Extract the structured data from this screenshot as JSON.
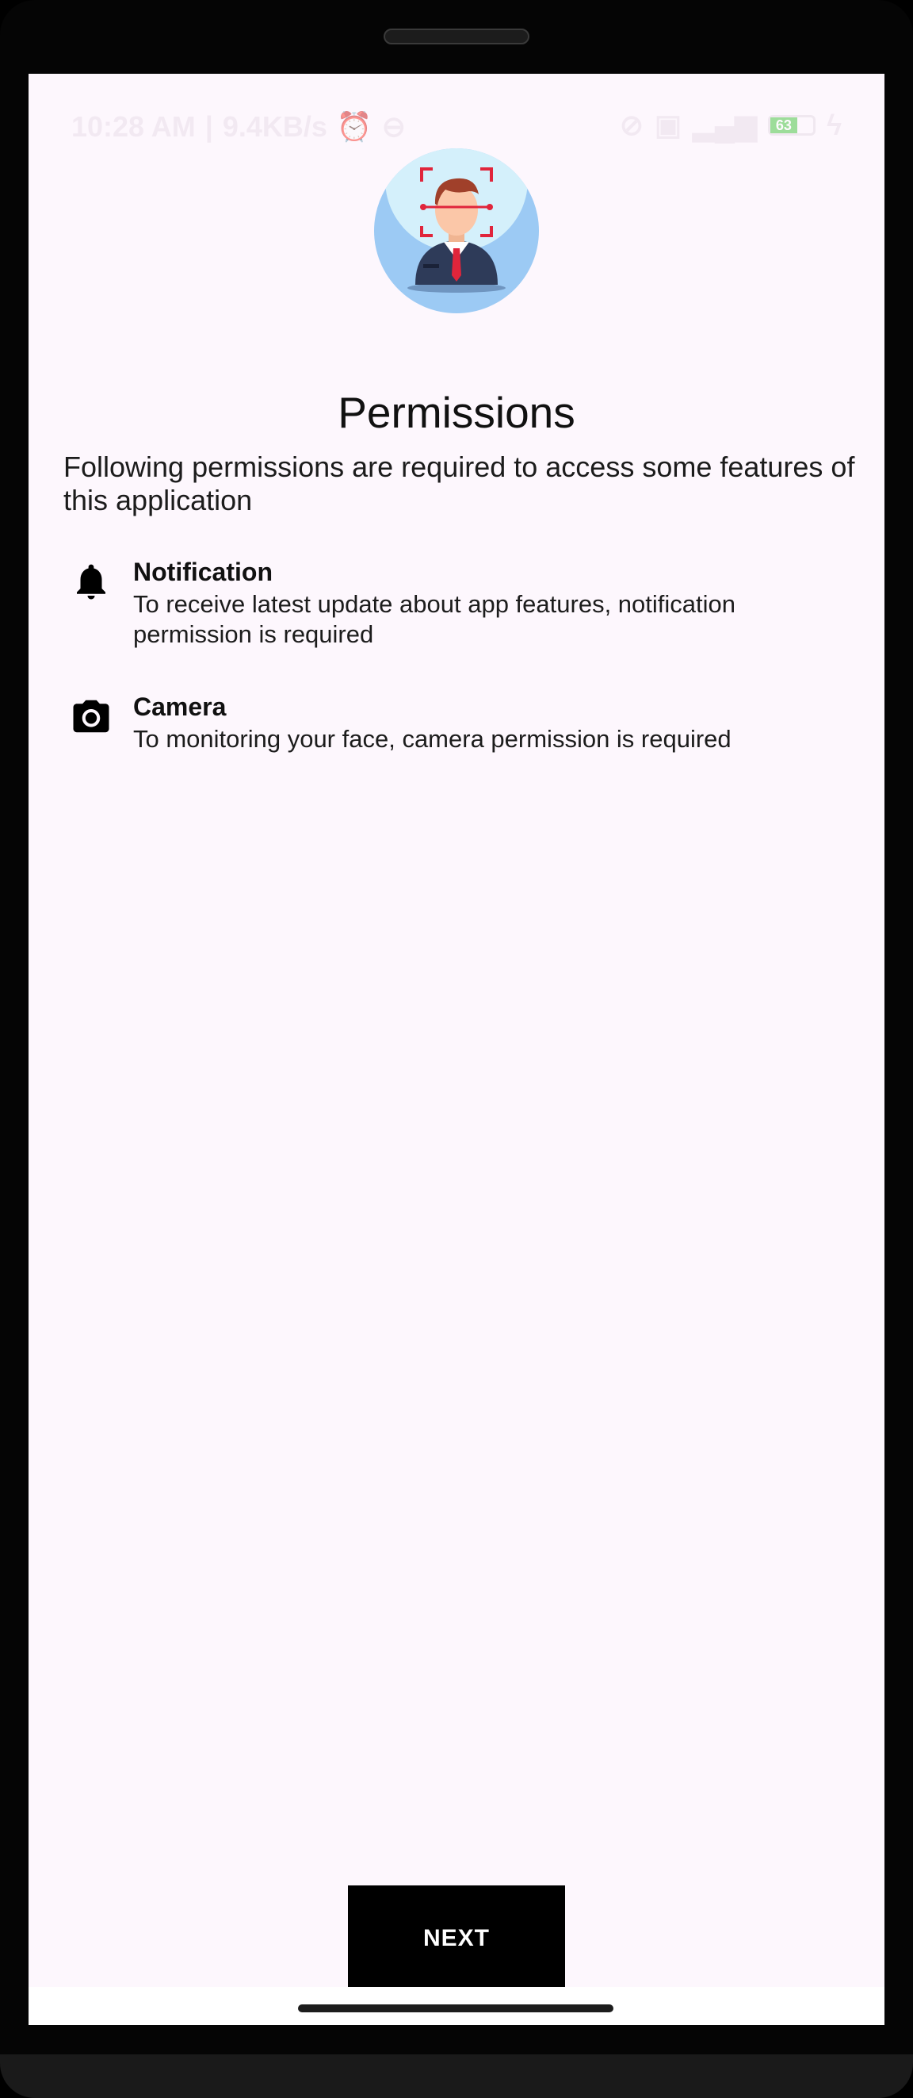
{
  "status_bar": {
    "time": "10:28 AM",
    "speed": "9.4KB/s",
    "battery_level": "63",
    "icons": [
      "alarm-icon",
      "do-not-disturb-icon",
      "nfc-icon",
      "sim-icon",
      "signal-icon",
      "battery-icon",
      "charging-icon"
    ]
  },
  "page": {
    "title": "Permissions",
    "intro": "Following permissions are required to access some features of this application"
  },
  "permissions": [
    {
      "icon": "bell-icon",
      "title": "Notification",
      "description": "To receive latest update about app features, notification permission is required"
    },
    {
      "icon": "camera-icon",
      "title": "Camera",
      "description": "To monitoring your face, camera permission is required"
    }
  ],
  "actions": {
    "next_label": "NEXT"
  },
  "colors": {
    "background": "#fdf7fd",
    "avatar_bg": "#9ccaf4",
    "button_bg": "#000000",
    "battery": "#4fc84a"
  }
}
